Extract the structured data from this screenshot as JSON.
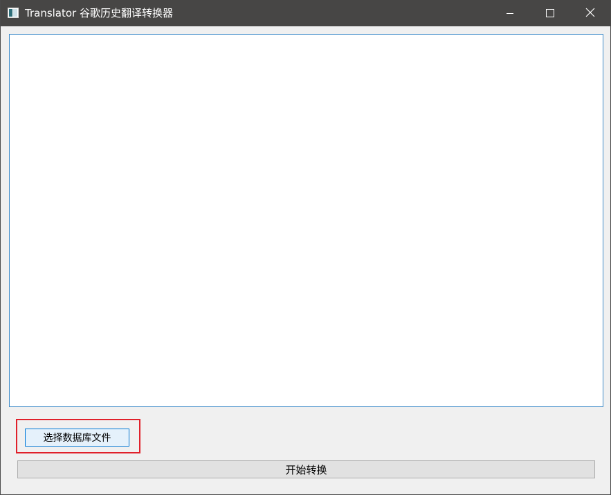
{
  "window": {
    "title": "Translator 谷歌历史翻译转换器",
    "icons": {
      "app": "app-window-icon",
      "minimize": "minimize-icon",
      "maximize": "maximize-icon",
      "close": "close-icon"
    }
  },
  "main": {
    "text_area_value": ""
  },
  "buttons": {
    "select_db_label": "选择数据库文件",
    "start_convert_label": "开始转换"
  },
  "colors": {
    "titlebar": "#474645",
    "focus_border": "#0078d7",
    "highlight": "#e0202a"
  }
}
